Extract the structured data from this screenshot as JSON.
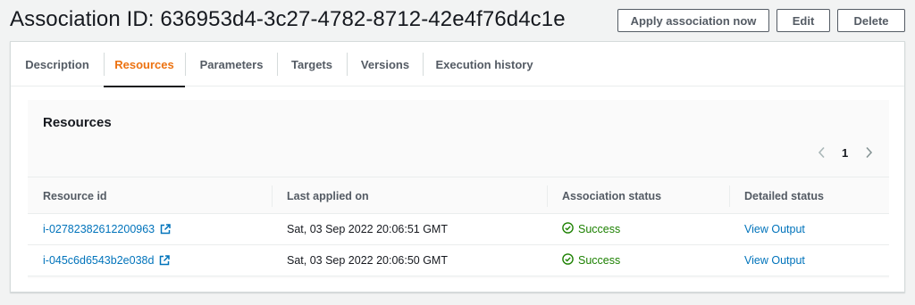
{
  "header": {
    "title": "Association ID: 636953d4-3c27-4782-8712-42e4f76d4c1e",
    "buttons": {
      "apply": "Apply association now",
      "edit": "Edit",
      "delete": "Delete"
    }
  },
  "tabs": [
    {
      "label": "Description",
      "active": false
    },
    {
      "label": "Resources",
      "active": true
    },
    {
      "label": "Parameters",
      "active": false
    },
    {
      "label": "Targets",
      "active": false
    },
    {
      "label": "Versions",
      "active": false
    },
    {
      "label": "Execution history",
      "active": false
    }
  ],
  "resources": {
    "title": "Resources",
    "pagination": {
      "current_page": "1",
      "prev_icon": "chevron-left-icon",
      "next_icon": "chevron-right-icon"
    },
    "columns": [
      "Resource id",
      "Last applied on",
      "Association status",
      "Detailed status"
    ],
    "rows": [
      {
        "resource_id": "i-02782382612200963",
        "last_applied": "Sat, 03 Sep 2022 20:06:51 GMT",
        "status": "Success",
        "detailed": "View Output"
      },
      {
        "resource_id": "i-045c6d6543b2e038d",
        "last_applied": "Sat, 03 Sep 2022 20:06:50 GMT",
        "status": "Success",
        "detailed": "View Output"
      }
    ]
  },
  "colors": {
    "accent_orange": "#ec7211",
    "link_blue": "#0073bb",
    "success_green": "#1d8102"
  }
}
